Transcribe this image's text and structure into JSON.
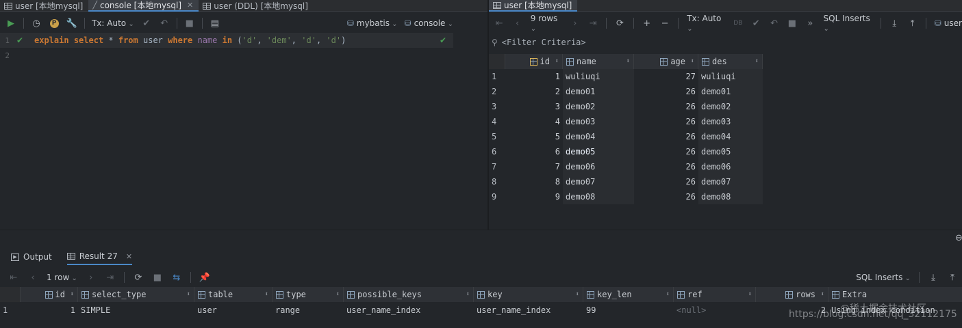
{
  "tabs_left": [
    {
      "label": "user [本地mysql]",
      "active": false
    },
    {
      "label": "console [本地mysql]",
      "active": true
    },
    {
      "label": "user (DDL) [本地mysql]",
      "active": false
    }
  ],
  "tabs_right": [
    {
      "label": "user [本地mysql]",
      "active": true
    }
  ],
  "editor_toolbar": {
    "tx_mode": "Tx: Auto",
    "schema": "mybatis",
    "session": "console"
  },
  "editor": {
    "line_numbers": [
      "1",
      "2"
    ],
    "query_tokens": [
      {
        "t": "explain",
        "c": "kw"
      },
      {
        "t": " ",
        "c": "plain"
      },
      {
        "t": "select",
        "c": "kw"
      },
      {
        "t": " * ",
        "c": "plain"
      },
      {
        "t": "from",
        "c": "kw"
      },
      {
        "t": " user ",
        "c": "plain"
      },
      {
        "t": "where",
        "c": "kw"
      },
      {
        "t": " ",
        "c": "plain"
      },
      {
        "t": "name",
        "c": "col"
      },
      {
        "t": " ",
        "c": "plain"
      },
      {
        "t": "in",
        "c": "kw"
      },
      {
        "t": " (",
        "c": "plain"
      },
      {
        "t": "'d'",
        "c": "str"
      },
      {
        "t": ", ",
        "c": "plain"
      },
      {
        "t": "'dem'",
        "c": "str"
      },
      {
        "t": ", ",
        "c": "plain"
      },
      {
        "t": "'d'",
        "c": "str"
      },
      {
        "t": ", ",
        "c": "plain"
      },
      {
        "t": "'d'",
        "c": "str"
      },
      {
        "t": ")",
        "c": "plain"
      }
    ]
  },
  "data_toolbar": {
    "rows_label": "9 rows",
    "tx_mode": "Tx: Auto",
    "export_mode": "SQL Inserts",
    "table": "user"
  },
  "filter_placeholder": "<Filter Criteria>",
  "user_table": {
    "columns": [
      "id",
      "name",
      "age",
      "des"
    ],
    "rows": [
      {
        "n": "1",
        "id": "1",
        "name": "wuliuqi",
        "age": "27",
        "des": "wuliuqi"
      },
      {
        "n": "2",
        "id": "2",
        "name": "demo01",
        "age": "26",
        "des": "demo01"
      },
      {
        "n": "3",
        "id": "3",
        "name": "demo02",
        "age": "26",
        "des": "demo02"
      },
      {
        "n": "4",
        "id": "4",
        "name": "demo03",
        "age": "26",
        "des": "demo03"
      },
      {
        "n": "5",
        "id": "5",
        "name": "demo04",
        "age": "26",
        "des": "demo04"
      },
      {
        "n": "6",
        "id": "6",
        "name": "demo05",
        "age": "26",
        "des": "demo05"
      },
      {
        "n": "7",
        "id": "7",
        "name": "demo06",
        "age": "26",
        "des": "demo06"
      },
      {
        "n": "8",
        "id": "8",
        "name": "demo07",
        "age": "26",
        "des": "demo07"
      },
      {
        "n": "9",
        "id": "9",
        "name": "demo08",
        "age": "26",
        "des": "demo08"
      }
    ],
    "selected_row": "6"
  },
  "bottom_tabs": {
    "output": "Output",
    "result": "Result 27"
  },
  "result_toolbar": {
    "rows_label": "1 row",
    "export_mode": "SQL Inserts"
  },
  "explain_table": {
    "columns": [
      "id",
      "select_type",
      "table",
      "type",
      "possible_keys",
      "key",
      "key_len",
      "ref",
      "rows",
      "Extra"
    ],
    "row": {
      "n": "1",
      "id": "1",
      "select_type": "SIMPLE",
      "table": "user",
      "type": "range",
      "possible_keys": "user_name_index",
      "key": "user_name_index",
      "key_len": "99",
      "ref": "<null>",
      "rows": "2",
      "Extra": "Using index condition"
    }
  },
  "watermarks": {
    "community": "@稀土掘金技术社区",
    "url": "https://blog.csdn.net/qq_32112175"
  },
  "colors": {
    "accent": "#4a88c7",
    "run_green": "#499c54",
    "selection": "#2f5a9a",
    "keyword": "#cc7832"
  }
}
